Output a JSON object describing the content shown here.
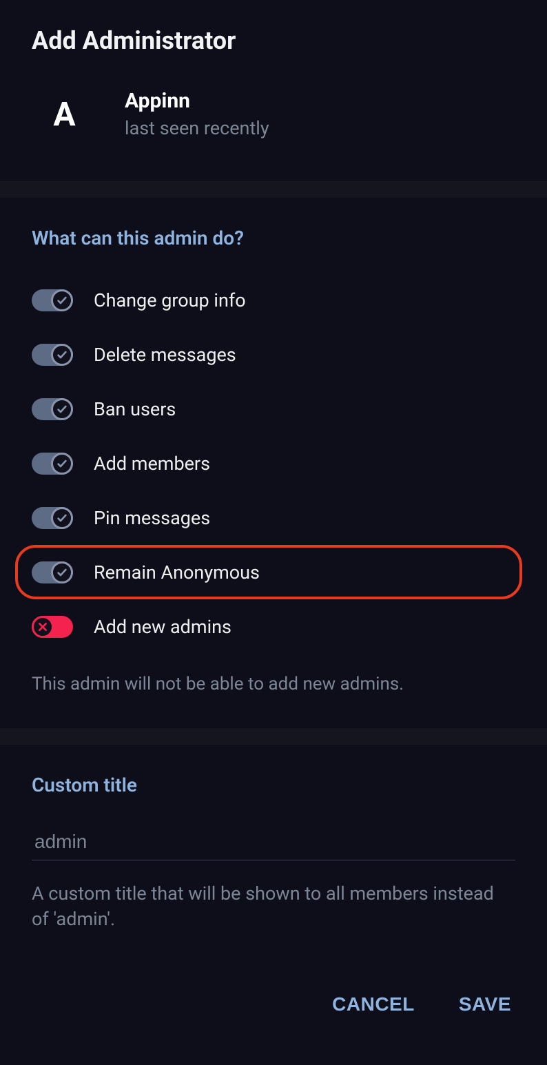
{
  "title": "Add Administrator",
  "user": {
    "initial": "A",
    "name": "Appinn",
    "status": "last seen recently"
  },
  "permissions": {
    "section_title": "What can this admin do?",
    "items": [
      {
        "id": "change-group-info",
        "label": "Change group info",
        "on": true,
        "highlighted": false
      },
      {
        "id": "delete-messages",
        "label": "Delete messages",
        "on": true,
        "highlighted": false
      },
      {
        "id": "ban-users",
        "label": "Ban users",
        "on": true,
        "highlighted": false
      },
      {
        "id": "add-members",
        "label": "Add members",
        "on": true,
        "highlighted": false
      },
      {
        "id": "pin-messages",
        "label": "Pin messages",
        "on": true,
        "highlighted": false
      },
      {
        "id": "remain-anonymous",
        "label": "Remain Anonymous",
        "on": true,
        "highlighted": true
      },
      {
        "id": "add-new-admins",
        "label": "Add new admins",
        "on": false,
        "highlighted": false
      }
    ],
    "hint": "This admin will not be able to add new admins."
  },
  "custom_title": {
    "section_title": "Custom title",
    "value": "",
    "placeholder": "admin",
    "description": "A custom title that will be shown to all members instead of 'admin'."
  },
  "actions": {
    "cancel": "CANCEL",
    "save": "SAVE"
  },
  "icons": {
    "check": "check-icon",
    "cross": "cross-icon"
  }
}
